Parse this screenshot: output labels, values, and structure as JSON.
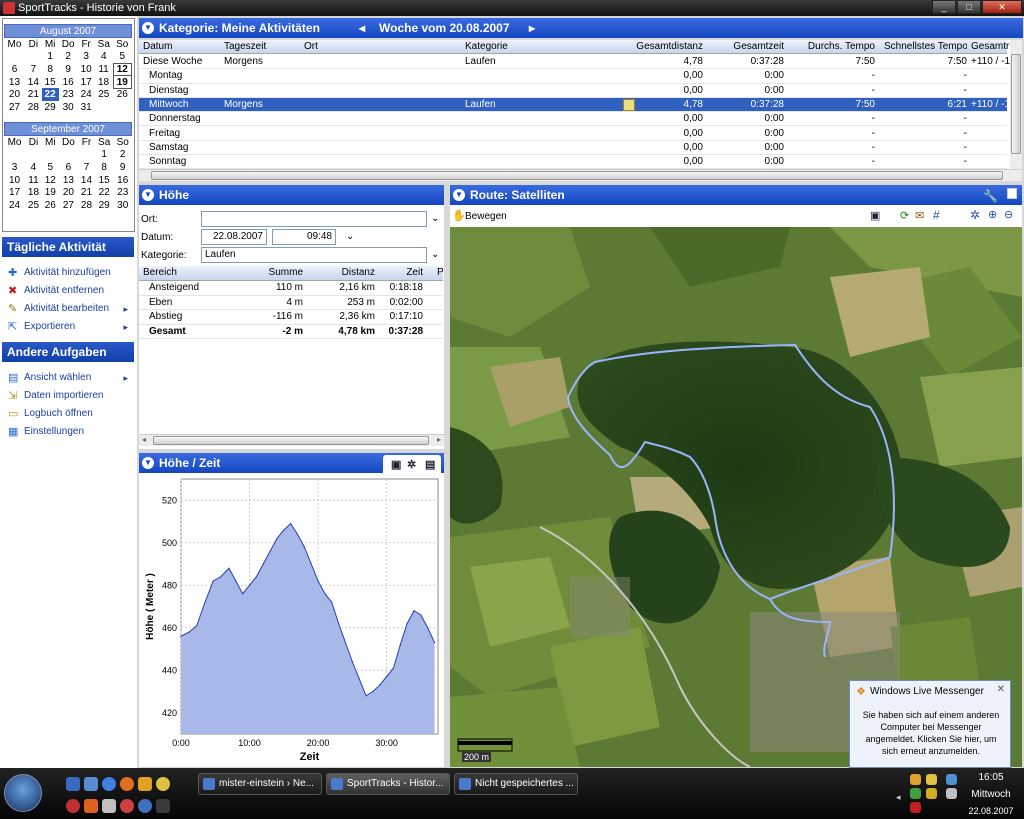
{
  "window": {
    "title": "SportTracks - Historie von Frank"
  },
  "calendar": {
    "weekdays": [
      "Mo",
      "Di",
      "Mi",
      "Do",
      "Fr",
      "Sa",
      "So"
    ],
    "months": [
      {
        "name": "August 2007",
        "weeks": [
          [
            "",
            "",
            "1",
            "2",
            "3",
            "4",
            "5"
          ],
          [
            "6",
            "7",
            "8",
            "9",
            "10",
            "11",
            "12"
          ],
          [
            "13",
            "14",
            "15",
            "16",
            "17",
            "18",
            "19"
          ],
          [
            "20",
            "21",
            "22",
            "23",
            "24",
            "25",
            "26"
          ],
          [
            "27",
            "28",
            "29",
            "30",
            "31",
            "",
            ""
          ]
        ]
      },
      {
        "name": "September 2007",
        "weeks": [
          [
            "",
            "",
            "",
            "",
            "",
            "1",
            "2"
          ],
          [
            "3",
            "4",
            "5",
            "6",
            "7",
            "8",
            "9"
          ],
          [
            "10",
            "11",
            "12",
            "13",
            "14",
            "15",
            "16"
          ],
          [
            "17",
            "18",
            "19",
            "20",
            "21",
            "22",
            "23"
          ],
          [
            "24",
            "25",
            "26",
            "27",
            "28",
            "29",
            "30"
          ]
        ]
      }
    ],
    "selected_day": "22",
    "bold_days": [
      "12",
      "19"
    ]
  },
  "daily_tasks": {
    "title": "Tägliche Aktivität",
    "items": [
      {
        "label": "Aktivität hinzufügen",
        "icon": "add-activity-icon",
        "glyph": "✚",
        "color": "#2a6ad0",
        "submenu": false
      },
      {
        "label": "Aktivität entfernen",
        "icon": "delete-icon",
        "glyph": "✖",
        "color": "#c02020",
        "submenu": false
      },
      {
        "label": "Aktivität bearbeiten",
        "icon": "pencil-icon",
        "glyph": "✎",
        "color": "#a07010",
        "submenu": true
      },
      {
        "label": "Exportieren",
        "icon": "export-icon",
        "glyph": "⇱",
        "color": "#2a6ad0",
        "submenu": true
      }
    ]
  },
  "other_tasks": {
    "title": "Andere Aufgaben",
    "items": [
      {
        "label": "Ansicht wählen",
        "icon": "view-icon",
        "glyph": "▤",
        "color": "#2a6ad0",
        "submenu": true
      },
      {
        "label": "Daten importieren",
        "icon": "import-icon",
        "glyph": "⇲",
        "color": "#c09010",
        "submenu": false
      },
      {
        "label": "Logbuch öffnen",
        "icon": "logbook-icon",
        "glyph": "▭",
        "color": "#c09010",
        "submenu": false
      },
      {
        "label": "Einstellungen",
        "icon": "settings-icon",
        "glyph": "▦",
        "color": "#2a6ad0",
        "submenu": false
      }
    ]
  },
  "category_panel": {
    "title": "Kategorie: Meine Aktivitäten",
    "week_label": "Woche vom 20.08.2007",
    "prev_glyph": "◂",
    "next_glyph": "▸",
    "columns": [
      "Datum",
      "Tageszeit",
      "Ort",
      "Kategorie",
      "Gesamtdistanz",
      "Gesamtzeit",
      "Durchs. Tempo",
      "Schnellstes Tempo",
      "Gesamtr"
    ],
    "rows": [
      {
        "datum": "Diese Woche",
        "tageszeit": "Morgens",
        "ort": "",
        "kategorie": "Laufen",
        "distanz": "4,78",
        "zeit": "0:37:28",
        "tempo": "7:50",
        "schnell": "7:50",
        "gesamt": "+110 / -1",
        "sel": false,
        "note": false
      },
      {
        "datum": "Montag",
        "tageszeit": "",
        "ort": "",
        "kategorie": "",
        "distanz": "0,00",
        "zeit": "0:00",
        "tempo": "-",
        "schnell": "-",
        "gesamt": "",
        "sel": false,
        "note": false
      },
      {
        "datum": "Dienstag",
        "tageszeit": "",
        "ort": "",
        "kategorie": "",
        "distanz": "0,00",
        "zeit": "0:00",
        "tempo": "-",
        "schnell": "-",
        "gesamt": "",
        "sel": false,
        "note": false
      },
      {
        "datum": "Mittwoch",
        "tageszeit": "Morgens",
        "ort": "",
        "kategorie": "Laufen",
        "distanz": "4,78",
        "zeit": "0:37:28",
        "tempo": "7:50",
        "schnell": "6:21",
        "gesamt": "+110 / -1",
        "sel": true,
        "note": true
      },
      {
        "datum": "Donnerstag",
        "tageszeit": "",
        "ort": "",
        "kategorie": "",
        "distanz": "0,00",
        "zeit": "0:00",
        "tempo": "-",
        "schnell": "-",
        "gesamt": "",
        "sel": false,
        "note": false
      },
      {
        "datum": "Freitag",
        "tageszeit": "",
        "ort": "",
        "kategorie": "",
        "distanz": "0,00",
        "zeit": "0:00",
        "tempo": "-",
        "schnell": "-",
        "gesamt": "",
        "sel": false,
        "note": false
      },
      {
        "datum": "Samstag",
        "tageszeit": "",
        "ort": "",
        "kategorie": "",
        "distanz": "0,00",
        "zeit": "0:00",
        "tempo": "-",
        "schnell": "-",
        "gesamt": "",
        "sel": false,
        "note": false
      },
      {
        "datum": "Sonntag",
        "tageszeit": "",
        "ort": "",
        "kategorie": "",
        "distanz": "0,00",
        "zeit": "0:00",
        "tempo": "-",
        "schnell": "-",
        "gesamt": "",
        "sel": false,
        "note": false
      }
    ]
  },
  "hoehe_panel": {
    "title": "Höhe",
    "ort_label": "Ort:",
    "ort_value": "",
    "datum_label": "Datum:",
    "datum_value": "22.08.2007",
    "time_value": "09:48",
    "kategorie_label": "Kategorie:",
    "kategorie_value": "Laufen",
    "columns": [
      "Bereich",
      "Summe",
      "Distanz",
      "Zeit",
      "P"
    ],
    "rows": [
      {
        "bereich": "Ansteigend",
        "summe": "110 m",
        "distanz": "2,16 km",
        "zeit": "0:18:18",
        "bold": false
      },
      {
        "bereich": "Eben",
        "summe": "4 m",
        "distanz": "253 m",
        "zeit": "0:02:00",
        "bold": false
      },
      {
        "bereich": "Abstieg",
        "summe": "-116 m",
        "distanz": "2,36 km",
        "zeit": "0:17:10",
        "bold": false
      },
      {
        "bereich": "Gesamt",
        "summe": "-2 m",
        "distanz": "4,78 km",
        "zeit": "0:37:28",
        "bold": true
      }
    ]
  },
  "chart_panel": {
    "title": "Höhe / Zeit"
  },
  "chart_data": {
    "type": "area",
    "title": "",
    "xlabel": "Zeit",
    "ylabel": "Höhe ( Meter )",
    "x_ticks": [
      "0:00",
      "10:00",
      "20:00",
      "30:00"
    ],
    "y_ticks": [
      420,
      440,
      460,
      480,
      500,
      520
    ],
    "xlim": [
      0,
      37.5
    ],
    "ylim": [
      410,
      530
    ],
    "grid": true,
    "color": "#a8b8e8",
    "x": [
      0,
      1.2,
      2.3,
      3.5,
      4.7,
      5.8,
      7,
      8,
      9,
      10,
      11,
      12,
      13,
      14,
      15,
      16,
      17,
      18,
      19,
      20,
      21,
      22,
      23,
      24,
      25,
      26,
      27,
      28,
      29,
      30,
      31,
      32,
      33,
      34,
      35,
      36,
      37
    ],
    "y": [
      456,
      458,
      461,
      472,
      482,
      484,
      488,
      482,
      476,
      480,
      484,
      490,
      496,
      502,
      506,
      509,
      504,
      498,
      490,
      482,
      476,
      472,
      462,
      453,
      444,
      436,
      428,
      430,
      433,
      437,
      441,
      452,
      462,
      468,
      466,
      460,
      453
    ]
  },
  "route_panel": {
    "title": "Route: Satelliten",
    "pan_label": "Bewegen",
    "scale_label": "200 m"
  },
  "messenger": {
    "title": "Windows Live Messenger",
    "text": "Sie haben sich auf einem anderen Computer bei Messenger angemeldet. Klicken Sie hier, um sich erneut anzumelden."
  },
  "taskbar": {
    "buttons": [
      {
        "label": "mister-einstein › Ne...",
        "active": false
      },
      {
        "label": "SportTracks - Histor...",
        "active": true
      },
      {
        "label": "Nicht gespeichertes ...",
        "active": false
      }
    ],
    "time": "16:05",
    "day": "Mittwoch",
    "date": "22.08.2007"
  }
}
